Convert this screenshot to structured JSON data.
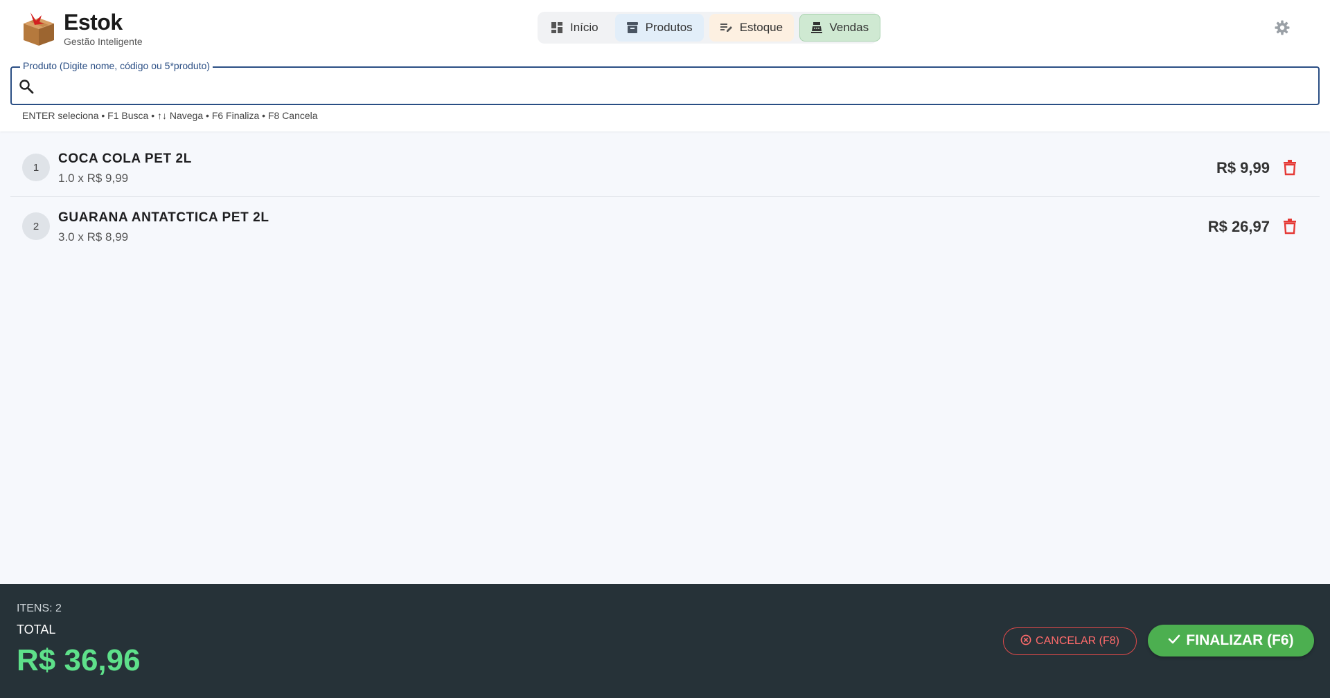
{
  "brand": {
    "title": "Estok",
    "subtitle": "Gestão Inteligente"
  },
  "nav": {
    "tabs": [
      {
        "label": "Início",
        "icon": "dashboard-icon"
      },
      {
        "label": "Produtos",
        "icon": "archive-icon"
      },
      {
        "label": "Estoque",
        "icon": "edit-list-icon"
      },
      {
        "label": "Vendas",
        "icon": "cash-register-icon",
        "active": true
      }
    ]
  },
  "search": {
    "label": "Produto (Digite nome, código ou 5*produto)",
    "value": "",
    "shortcuts": "ENTER seleciona • F1 Busca • ↑↓ Navega • F6 Finaliza • F8 Cancela"
  },
  "items": [
    {
      "num": "1",
      "name": "COCA COLA PET 2L",
      "detail": "1.0 x R$ 9,99",
      "total": "R$ 9,99"
    },
    {
      "num": "2",
      "name": "GUARANA ANTATCTICA PET 2L",
      "detail": "3.0 x R$ 8,99",
      "total": "R$ 26,97"
    }
  ],
  "footer": {
    "itens": "ITENS: 2",
    "total_label": "TOTAL",
    "total": "R$ 36,96",
    "cancel_label": "CANCELAR (F8)",
    "finalize_label": "FINALIZAR (F6)"
  },
  "colors": {
    "primary": "#2a4e84",
    "footer_bg": "#263238",
    "total_green": "#5ee08a",
    "finalize_green": "#4caf50",
    "danger": "#e53935"
  }
}
